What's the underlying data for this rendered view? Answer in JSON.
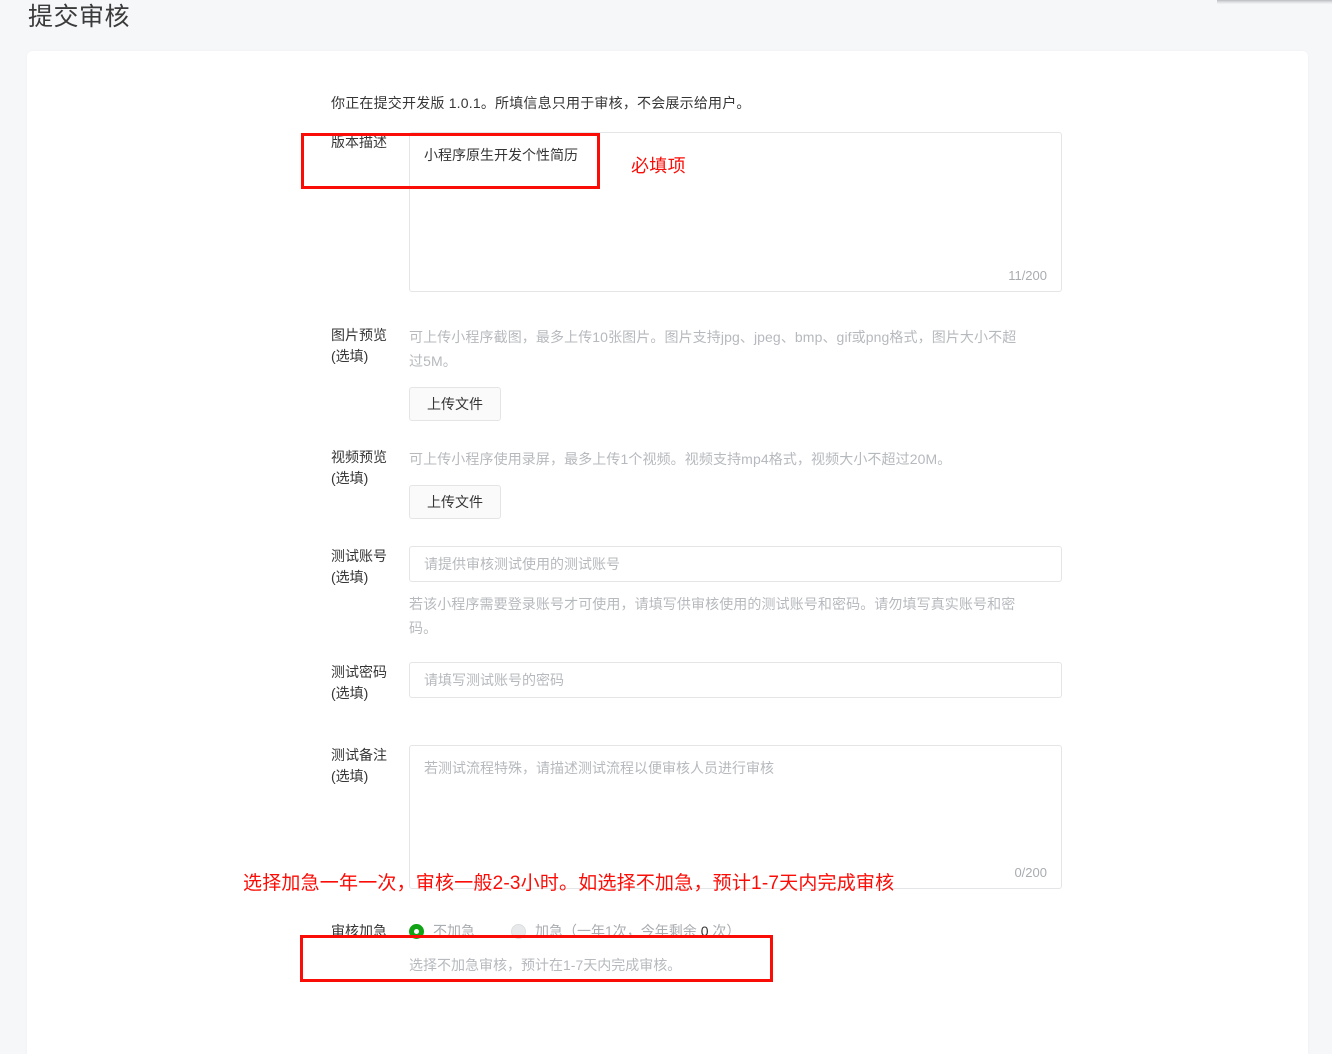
{
  "page": {
    "title": "提交审核"
  },
  "form": {
    "intro": "你正在提交开发版 1.0.1。所填信息只用于审核，不会展示给用户。",
    "version_desc": {
      "label": "版本描述",
      "value": "小程序原生开发个性简历",
      "counter": "11/200"
    },
    "image_preview": {
      "label": "图片预览",
      "sub_label": "(选填)",
      "hint": "可上传小程序截图，最多上传10张图片。图片支持jpg、jpeg、bmp、gif或png格式，图片大小不超过5M。",
      "upload_label": "上传文件"
    },
    "video_preview": {
      "label": "视频预览",
      "sub_label": "(选填)",
      "hint": "可上传小程序使用录屏，最多上传1个视频。视频支持mp4格式，视频大小不超过20M。",
      "upload_label": "上传文件"
    },
    "test_account": {
      "label": "测试账号",
      "sub_label": "(选填)",
      "placeholder": "请提供审核测试使用的测试账号",
      "hint": "若该小程序需要登录账号才可使用，请填写供审核使用的测试账号和密码。请勿填写真实账号和密码。"
    },
    "test_password": {
      "label": "测试密码",
      "sub_label": "(选填)",
      "placeholder": "请填写测试账号的密码"
    },
    "test_note": {
      "label": "测试备注",
      "sub_label": "(选填)",
      "placeholder": "若测试流程特殊，请描述测试流程以便审核人员进行审核",
      "counter": "0/200"
    },
    "urgent": {
      "label": "审核加急",
      "option_normal": "不加急",
      "option_urgent": "加急（一年1次，今年剩余 ",
      "option_urgent_count": "0",
      "option_urgent_suffix": " 次）",
      "note": "选择不加急审核，预计在1-7天内完成审核。",
      "selected": "不加急"
    }
  },
  "annotations": {
    "required_note": "必填项",
    "urgent_note": "选择加急一年一次，审核一般2-3小时。如选择不加急，预计1-7天内完成审核",
    "color": "#fb0d07"
  },
  "colors": {
    "page_bg": "#f6f7f9",
    "card_bg": "#ffffff",
    "text": "#353535",
    "muted": "#b6b9bd",
    "radio_green": "#11a315",
    "annotation_red": "#fb0d07"
  }
}
